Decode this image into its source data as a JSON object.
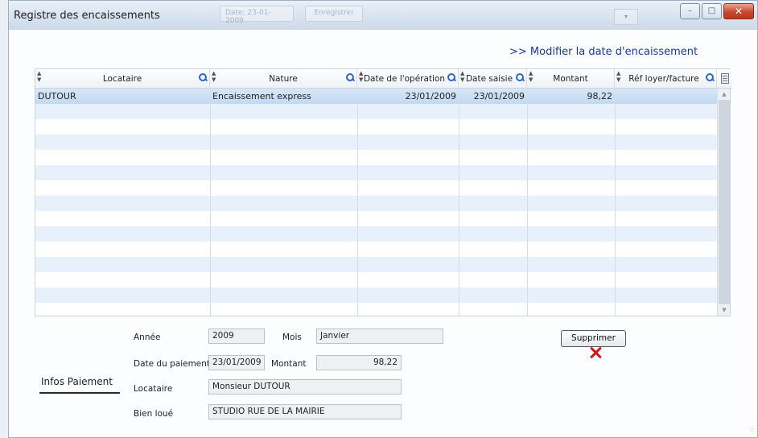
{
  "window": {
    "title": "Registre des encaissements",
    "ghost_date": "Date: 23-01-2009",
    "ghost_button": "Enregistrer",
    "ghost_dropdown": "▾",
    "controls": {
      "minimize": "–",
      "maximize": "□",
      "close": "✕"
    }
  },
  "link": {
    "modify_date": ">> Modifier la date d'encaissement"
  },
  "grid": {
    "columns": [
      "Locataire",
      "Nature",
      "Date de l'opération",
      "Date saisie",
      "Montant",
      "Réf loyer/facture"
    ],
    "rows": [
      {
        "locataire": "DUTOUR",
        "nature": "Encaissement express",
        "date_operation": "23/01/2009",
        "date_saisie": "23/01/2009",
        "montant": "98,22",
        "ref": ""
      }
    ],
    "empty_rows": 14,
    "scroll_up": "▲",
    "scroll_down": "▼"
  },
  "form": {
    "annee_label": "Année",
    "annee": "2009",
    "mois_label": "Mois",
    "mois": "Janvier",
    "date_paiement_label": "Date du paiement",
    "date_paiement": "23/01/2009",
    "montant_label": "Montant",
    "montant": "98,22",
    "locataire_label": "Locataire",
    "locataire": "Monsieur DUTOUR",
    "bien_label": "Bien loué",
    "bien": "STUDIO RUE DE LA MAIRIE",
    "section_label": "Infos Paiement"
  },
  "actions": {
    "supprimer": "Supprimer"
  },
  "colors": {
    "accent_link": "#1a3a9c",
    "row_alt": "#e8f1fb",
    "row_selected": "#c2d9f1",
    "delete_icon": "#cc1a1a"
  },
  "icons": [
    "search-icon",
    "sort-icon",
    "column-chooser-icon",
    "delete-x-icon"
  ]
}
